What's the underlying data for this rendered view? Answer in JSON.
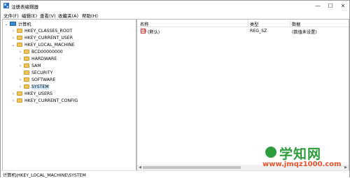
{
  "window": {
    "title": "注册表编辑器",
    "minimize": "—",
    "maximize": "☐",
    "close": "✕"
  },
  "menu": [
    "文件(F)",
    "编辑(E)",
    "查看(V)",
    "收藏夹(A)",
    "帮助(H)"
  ],
  "tree": {
    "root": "计算机",
    "hives": [
      {
        "label": "HKEY_CLASSES_ROOT",
        "expander": "›"
      },
      {
        "label": "HKEY_CURRENT_USER",
        "expander": "›"
      },
      {
        "label": "HKEY_LOCAL_MACHINE",
        "expander": "⌄"
      },
      {
        "label": "HKEY_USERS",
        "expander": "›"
      },
      {
        "label": "HKEY_CURRENT_CONFIG",
        "expander": "›"
      }
    ],
    "hklm_children": [
      {
        "label": "BCD00000000",
        "expander": "›"
      },
      {
        "label": "HARDWARE",
        "expander": "›"
      },
      {
        "label": "SAM",
        "expander": "›"
      },
      {
        "label": "SECURITY",
        "expander": ""
      },
      {
        "label": "SOFTWARE",
        "expander": "›"
      },
      {
        "label": "SYSTEM",
        "expander": "›",
        "selected": true
      }
    ]
  },
  "values": {
    "columns": [
      "名称",
      "类型",
      "数据"
    ],
    "rows": [
      {
        "name": "(默认)",
        "type": "REG_SZ",
        "data": "(数值未设置)",
        "icon": "ab-string-icon"
      }
    ]
  },
  "statusbar": {
    "path": "计算机\\HKEY_LOCAL_MACHINE\\SYSTEM"
  },
  "watermark": {
    "title": "学知网",
    "url": "www.jmqz1000.com"
  },
  "colors": {
    "folder": "#f2c55c",
    "selection": "#cde8ff",
    "watermark_green": "#2d9c3c",
    "watermark_orange": "#e8502a"
  }
}
